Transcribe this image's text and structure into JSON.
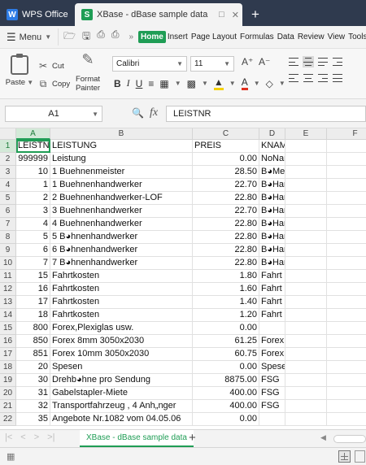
{
  "titlebar": {
    "app_tab": "WPS Office",
    "doc_tab": "XBase - dBase sample data",
    "new_tab": "+"
  },
  "menu": {
    "menu_label": "Menu",
    "ribbon_tabs": [
      "Home",
      "Insert",
      "Page Layout",
      "Formulas",
      "Data",
      "Review",
      "View",
      "Tools"
    ],
    "active_tab": "Home"
  },
  "ribbon": {
    "paste": "Paste",
    "cut": "Cut",
    "copy": "Copy",
    "format_painter_1": "Format",
    "format_painter_2": "Painter",
    "font_name": "Calibri",
    "font_size": "11",
    "grow": "A⁺",
    "shrink": "A⁻",
    "bold": "B",
    "italic": "I",
    "underline": "U"
  },
  "formula_bar": {
    "name_box": "A1",
    "fx": "fx",
    "formula": "LEISTNR"
  },
  "grid": {
    "columns": [
      "A",
      "B",
      "C",
      "D",
      "E",
      "F"
    ],
    "selected_column": "A",
    "selected_row": "1",
    "rows": [
      {
        "n": "1",
        "a": "LEISTNR",
        "b": "LEISTUNG",
        "c": "PREIS",
        "d": "KNAME"
      },
      {
        "n": "2",
        "a": "999999",
        "b": "Leistung",
        "c": "0.00",
        "d": "NoNam"
      },
      {
        "n": "3",
        "a": "10",
        "b": "1 Buehnenmeister",
        "c": "28.50",
        "d": "B◕Mei"
      },
      {
        "n": "4",
        "a": "1",
        "b": "1 Buehnenhandwerker",
        "c": "22.70",
        "d": "B◕Han"
      },
      {
        "n": "5",
        "a": "2",
        "b": "2 Buehnenhandwerker-LOF",
        "c": "22.80",
        "d": "B◕Han"
      },
      {
        "n": "6",
        "a": "3",
        "b": "3 Buehnenhandwerker",
        "c": "22.70",
        "d": "B◕Han"
      },
      {
        "n": "7",
        "a": "4",
        "b": "4 Buehnenhandwerker",
        "c": "22.80",
        "d": "B◕Han"
      },
      {
        "n": "8",
        "a": "5",
        "b": "5 B◕hnenhandwerker",
        "c": "22.80",
        "d": "B◕Han"
      },
      {
        "n": "9",
        "a": "6",
        "b": "6 B◕hnenhandwerker",
        "c": "22.80",
        "d": "B◕Han"
      },
      {
        "n": "10",
        "a": "7",
        "b": "7 B◕hnenhandwerker",
        "c": "22.80",
        "d": "B◕Han"
      },
      {
        "n": "11",
        "a": "15",
        "b": "Fahrtkosten",
        "c": "1.80",
        "d": "Fahrt"
      },
      {
        "n": "12",
        "a": "16",
        "b": "Fahrtkosten",
        "c": "1.60",
        "d": "Fahrt"
      },
      {
        "n": "13",
        "a": "17",
        "b": "Fahrtkosten",
        "c": "1.40",
        "d": "Fahrt"
      },
      {
        "n": "14",
        "a": "18",
        "b": "Fahrtkosten",
        "c": "1.20",
        "d": "Fahrt"
      },
      {
        "n": "15",
        "a": "800",
        "b": "Forex,Plexiglas usw.",
        "c": "0.00",
        "d": ""
      },
      {
        "n": "16",
        "a": "850",
        "b": "Forex 8mm 3050x2030",
        "c": "61.25",
        "d": "Forex"
      },
      {
        "n": "17",
        "a": "851",
        "b": "Forex 10mm 3050x2030",
        "c": "60.75",
        "d": "Forex"
      },
      {
        "n": "18",
        "a": "20",
        "b": "Spesen",
        "c": "0.00",
        "d": "Spese"
      },
      {
        "n": "19",
        "a": "30",
        "b": "Drehb◕hne pro Sendung",
        "c": "8875.00",
        "d": "FSG"
      },
      {
        "n": "20",
        "a": "31",
        "b": "Gabelstapler-Miete",
        "c": "400.00",
        "d": "FSG"
      },
      {
        "n": "21",
        "a": "32",
        "b": "Transportfahrzeug , 4 Anh„nger",
        "c": "400.00",
        "d": "FSG"
      },
      {
        "n": "22",
        "a": "35",
        "b": "Angebote Nr.1082 vom 04.05.06",
        "c": "0.00",
        "d": ""
      }
    ]
  },
  "sheets": {
    "tabs": [
      "XBase - dBase sample data"
    ],
    "add": "+"
  },
  "colors": {
    "accent": "#1f9d55",
    "titlebar": "#2f3a4e"
  }
}
